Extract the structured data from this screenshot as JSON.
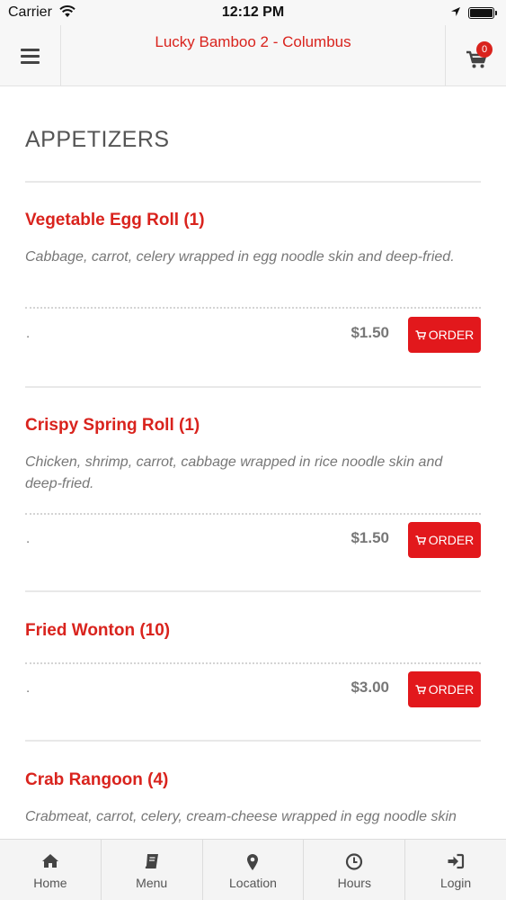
{
  "status_bar": {
    "carrier": "Carrier",
    "time": "12:12 PM"
  },
  "header": {
    "title": "Lucky Bamboo 2 - Columbus",
    "cart_count": "0"
  },
  "section": {
    "title": "APPETIZERS"
  },
  "items": [
    {
      "name": "Vegetable Egg Roll (1)",
      "description": "Cabbage, carrot, celery wrapped in egg noodle skin and deep-fried.",
      "note": ".",
      "price": "$1.50",
      "order_label": "ORDER"
    },
    {
      "name": "Crispy Spring Roll (1)",
      "description": "Chicken, shrimp, carrot, cabbage wrapped in rice noodle skin and deep-fried.",
      "note": ".",
      "price": "$1.50",
      "order_label": "ORDER"
    },
    {
      "name": "Fried Wonton (10)",
      "description": "",
      "note": ".",
      "price": "$3.00",
      "order_label": "ORDER"
    },
    {
      "name": "Crab Rangoon (4)",
      "description": "Crabmeat, carrot, celery, cream-cheese wrapped in egg noodle skin"
    }
  ],
  "tabs": [
    {
      "label": "Home",
      "icon": "home-icon"
    },
    {
      "label": "Menu",
      "icon": "book-icon"
    },
    {
      "label": "Location",
      "icon": "map-pin-icon"
    },
    {
      "label": "Hours",
      "icon": "clock-icon"
    },
    {
      "label": "Login",
      "icon": "sign-in-icon"
    }
  ],
  "colors": {
    "accent": "#d9231d",
    "order_button": "#e2181c",
    "bar_background": "#f7f7f7"
  }
}
